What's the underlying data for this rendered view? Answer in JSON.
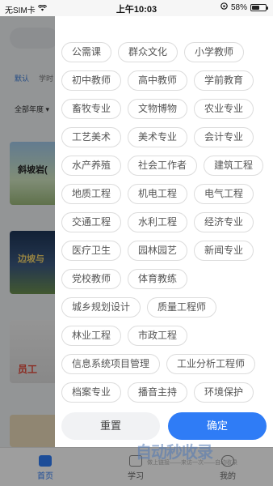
{
  "status_bar": {
    "carrier": "无SIM卡",
    "time": "上午10:03",
    "battery_percent": "58%",
    "battery_level": 0.58
  },
  "background": {
    "tabs": [
      "默认",
      "学时"
    ],
    "year_filter": "全部年度",
    "cards": [
      "斜坡岩(",
      "边坡与",
      "员工"
    ]
  },
  "filter": {
    "tags": [
      "公需课",
      "群众文化",
      "小学教师",
      "初中教师",
      "高中教师",
      "学前教育",
      "畜牧专业",
      "文物博物",
      "农业专业",
      "工艺美术",
      "美术专业",
      "会计专业",
      "水产养殖",
      "社会工作者",
      "建筑工程",
      "地质工程",
      "机电工程",
      "电气工程",
      "交通工程",
      "水利工程",
      "经济专业",
      "医疗卫生",
      "园林园艺",
      "新闻专业",
      "党校教师",
      "体育教练",
      "城乡规划设计",
      "质量工程师",
      "林业工程",
      "市政工程",
      "信息系统项目管理",
      "工业分析工程师",
      "档案专业",
      "播音主持",
      "环境保护"
    ],
    "reset_label": "重置",
    "confirm_label": "确定"
  },
  "bottom_nav": {
    "items": [
      {
        "label": "首页",
        "icon": "home-icon"
      },
      {
        "label": "学习",
        "icon": "study-icon"
      },
      {
        "label": "我的",
        "icon": "profile-icon"
      }
    ]
  },
  "watermark": {
    "logo": "自动秒收录",
    "subtitle": "做上链接——来访一次——自动收录"
  },
  "colors": {
    "accent": "#2f7cf6",
    "overlay": "rgba(0,0,0,0.38)"
  }
}
